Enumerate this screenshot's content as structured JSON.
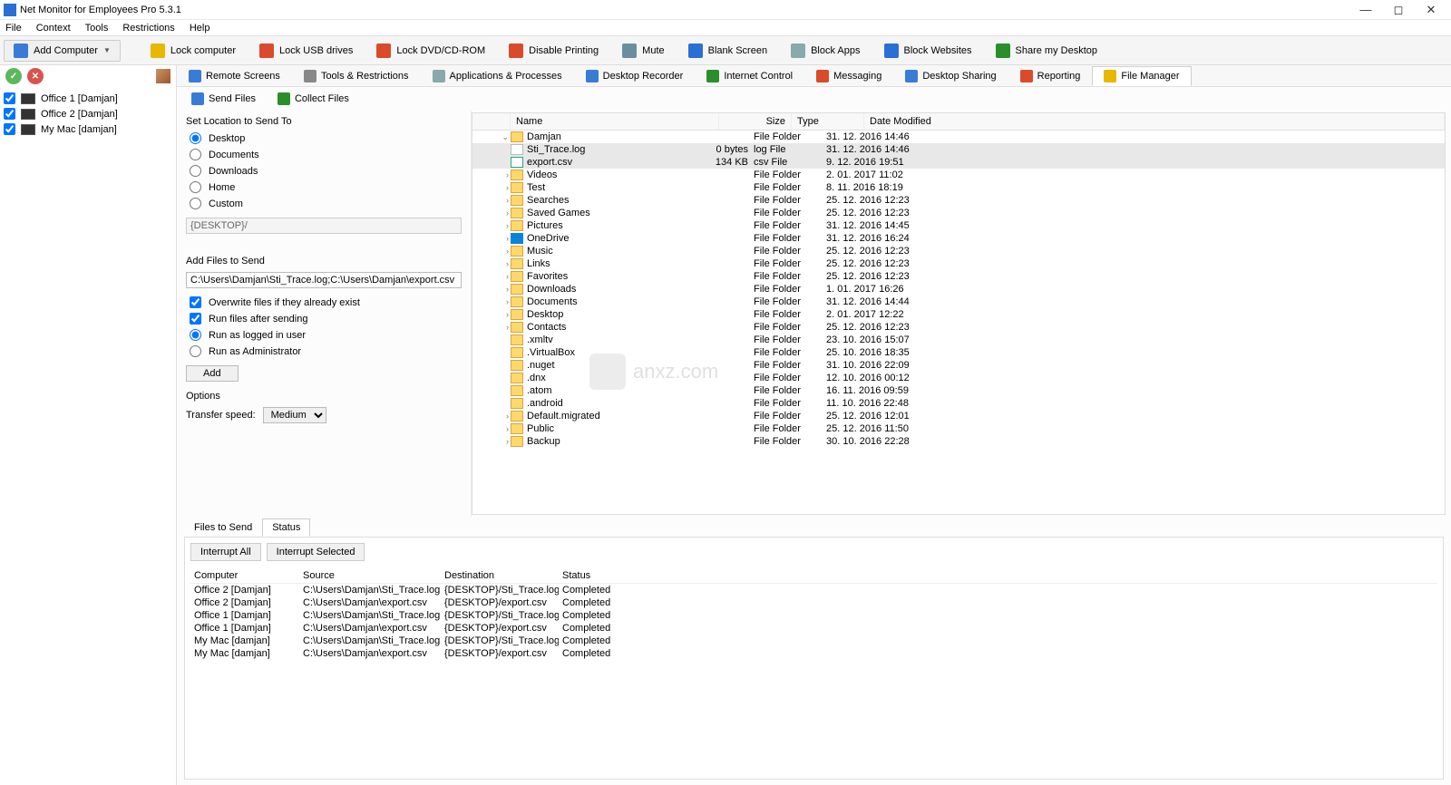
{
  "window": {
    "title": "Net Monitor for Employees Pro 5.3.1"
  },
  "menubar": [
    "File",
    "Context",
    "Tools",
    "Restrictions",
    "Help"
  ],
  "toolbar1": [
    {
      "label": "Add Computer",
      "dropdown": true,
      "color": "#3a7bd5"
    },
    {
      "label": "Lock computer",
      "color": "#e6b800"
    },
    {
      "label": "Lock USB drives",
      "color": "#d94b2b"
    },
    {
      "label": "Lock DVD/CD-ROM",
      "color": "#d94b2b"
    },
    {
      "label": "Disable Printing",
      "color": "#d94b2b"
    },
    {
      "label": "Mute",
      "color": "#6b8e9e"
    },
    {
      "label": "Blank Screen",
      "color": "#2a6fd6"
    },
    {
      "label": "Block Apps",
      "color": "#8aa"
    },
    {
      "label": "Block Websites",
      "color": "#2a6fd6"
    },
    {
      "label": "Share my Desktop",
      "color": "#2a8f2a"
    }
  ],
  "left_items": [
    {
      "label": "Office 1 [Damjan]"
    },
    {
      "label": "Office 2 [Damjan]"
    },
    {
      "label": "My Mac [damjan]"
    }
  ],
  "toolbar2_tabs": [
    {
      "label": "Remote Screens",
      "color": "#3a7bd5"
    },
    {
      "label": "Tools & Restrictions",
      "color": "#888"
    },
    {
      "label": "Applications & Processes",
      "color": "#8aa"
    },
    {
      "label": "Desktop Recorder",
      "color": "#3a7bd5"
    },
    {
      "label": "Internet Control",
      "color": "#2a8f2a"
    },
    {
      "label": "Messaging",
      "color": "#d94b2b"
    },
    {
      "label": "Desktop Sharing",
      "color": "#3a7bd5"
    },
    {
      "label": "Reporting",
      "color": "#d94b2b"
    },
    {
      "label": "File Manager",
      "color": "#e6b800",
      "active": true
    }
  ],
  "sub_toolbar": [
    {
      "label": "Send Files",
      "color": "#3a7bd5"
    },
    {
      "label": "Collect Files",
      "color": "#2a8f2a"
    }
  ],
  "settings": {
    "set_location_label": "Set Location to Send To",
    "loc_options": [
      "Desktop",
      "Documents",
      "Downloads",
      "Home",
      "Custom"
    ],
    "loc_selected": "Desktop",
    "path_display": "{DESKTOP}/",
    "add_files_label": "Add Files to Send",
    "files_input": "C:\\Users\\Damjan\\Sti_Trace.log;C:\\Users\\Damjan\\export.csv",
    "overwrite_label": "Overwrite files if they already exist",
    "run_after_label": "Run files after sending",
    "run_as_options": [
      "Run as logged in user",
      "Run as Administrator"
    ],
    "run_as_selected": "Run as logged in user",
    "add_button": "Add",
    "options_label": "Options",
    "transfer_speed_label": "Transfer speed:",
    "transfer_speed_value": "Medium"
  },
  "filelist": {
    "columns": [
      "Name",
      "Size",
      "Type",
      "Date Modified"
    ],
    "rows": [
      {
        "tree": "v",
        "indent": 0,
        "icon": "folder",
        "name": "Damjan",
        "size": "",
        "type": "File Folder",
        "date": "31. 12. 2016 14:46"
      },
      {
        "tree": "",
        "indent": 2,
        "icon": "file",
        "name": "Sti_Trace.log",
        "size": "0 bytes",
        "type": "log File",
        "date": "31. 12. 2016 14:46",
        "selected": true
      },
      {
        "tree": "",
        "indent": 2,
        "icon": "csv",
        "name": "export.csv",
        "size": "134 KB",
        "type": "csv File",
        "date": "9. 12. 2016 19:51",
        "selected": true
      },
      {
        "tree": ">",
        "indent": 1,
        "icon": "folder",
        "name": "Videos",
        "size": "",
        "type": "File Folder",
        "date": "2. 01. 2017 11:02"
      },
      {
        "tree": ">",
        "indent": 1,
        "icon": "folder",
        "name": "Test",
        "size": "",
        "type": "File Folder",
        "date": "8. 11. 2016 18:19"
      },
      {
        "tree": ">",
        "indent": 1,
        "icon": "folder",
        "name": "Searches",
        "size": "",
        "type": "File Folder",
        "date": "25. 12. 2016 12:23"
      },
      {
        "tree": ">",
        "indent": 1,
        "icon": "folder",
        "name": "Saved Games",
        "size": "",
        "type": "File Folder",
        "date": "25. 12. 2016 12:23"
      },
      {
        "tree": ">",
        "indent": 1,
        "icon": "folder",
        "name": "Pictures",
        "size": "",
        "type": "File Folder",
        "date": "31. 12. 2016 14:45"
      },
      {
        "tree": ">",
        "indent": 1,
        "icon": "onedrive",
        "name": "OneDrive",
        "size": "",
        "type": "File Folder",
        "date": "31. 12. 2016 16:24"
      },
      {
        "tree": ">",
        "indent": 1,
        "icon": "folder",
        "name": "Music",
        "size": "",
        "type": "File Folder",
        "date": "25. 12. 2016 12:23"
      },
      {
        "tree": ">",
        "indent": 1,
        "icon": "folder",
        "name": "Links",
        "size": "",
        "type": "File Folder",
        "date": "25. 12. 2016 12:23"
      },
      {
        "tree": ">",
        "indent": 1,
        "icon": "folder",
        "name": "Favorites",
        "size": "",
        "type": "File Folder",
        "date": "25. 12. 2016 12:23"
      },
      {
        "tree": ">",
        "indent": 1,
        "icon": "folder",
        "name": "Downloads",
        "size": "",
        "type": "File Folder",
        "date": "1. 01. 2017 16:26"
      },
      {
        "tree": ">",
        "indent": 1,
        "icon": "folder",
        "name": "Documents",
        "size": "",
        "type": "File Folder",
        "date": "31. 12. 2016 14:44"
      },
      {
        "tree": ">",
        "indent": 1,
        "icon": "folder",
        "name": "Desktop",
        "size": "",
        "type": "File Folder",
        "date": "2. 01. 2017 12:22"
      },
      {
        "tree": ">",
        "indent": 1,
        "icon": "folder",
        "name": "Contacts",
        "size": "",
        "type": "File Folder",
        "date": "25. 12. 2016 12:23"
      },
      {
        "tree": "",
        "indent": 1,
        "icon": "folder",
        "name": ".xmltv",
        "size": "",
        "type": "File Folder",
        "date": "23. 10. 2016 15:07"
      },
      {
        "tree": "",
        "indent": 1,
        "icon": "folder",
        "name": ".VirtualBox",
        "size": "",
        "type": "File Folder",
        "date": "25. 10. 2016 18:35"
      },
      {
        "tree": "",
        "indent": 1,
        "icon": "folder",
        "name": ".nuget",
        "size": "",
        "type": "File Folder",
        "date": "31. 10. 2016 22:09"
      },
      {
        "tree": "",
        "indent": 1,
        "icon": "folder",
        "name": ".dnx",
        "size": "",
        "type": "File Folder",
        "date": "12. 10. 2016 00:12"
      },
      {
        "tree": "",
        "indent": 1,
        "icon": "folder",
        "name": ".atom",
        "size": "",
        "type": "File Folder",
        "date": "16. 11. 2016 09:59"
      },
      {
        "tree": "",
        "indent": 1,
        "icon": "folder",
        "name": ".android",
        "size": "",
        "type": "File Folder",
        "date": "11. 10. 2016 22:48"
      },
      {
        "tree": ">",
        "indent": 0,
        "icon": "folder",
        "name": "Default.migrated",
        "size": "",
        "type": "File Folder",
        "date": "25. 12. 2016 12:01"
      },
      {
        "tree": ">",
        "indent": 0,
        "icon": "folder",
        "name": "Public",
        "size": "",
        "type": "File Folder",
        "date": "25. 12. 2016 11:50"
      },
      {
        "tree": ">",
        "indent": 0,
        "icon": "folder",
        "name": "Backup",
        "size": "",
        "type": "File Folder",
        "date": "30. 10. 2016 22:28"
      }
    ]
  },
  "bottom_tabs": {
    "tabs": [
      "Files to Send",
      "Status"
    ],
    "active": "Status"
  },
  "status_panel": {
    "interrupt_all": "Interrupt All",
    "interrupt_selected": "Interrupt Selected",
    "columns": [
      "Computer",
      "Source",
      "Destination",
      "Status"
    ],
    "rows": [
      {
        "computer": "Office 2 [Damjan]",
        "source": "C:\\Users\\Damjan\\Sti_Trace.log",
        "destination": "{DESKTOP}/Sti_Trace.log",
        "status": "Completed"
      },
      {
        "computer": "Office 2 [Damjan]",
        "source": "C:\\Users\\Damjan\\export.csv",
        "destination": "{DESKTOP}/export.csv",
        "status": "Completed"
      },
      {
        "computer": "Office 1 [Damjan]",
        "source": "C:\\Users\\Damjan\\Sti_Trace.log",
        "destination": "{DESKTOP}/Sti_Trace.log",
        "status": "Completed"
      },
      {
        "computer": "Office 1 [Damjan]",
        "source": "C:\\Users\\Damjan\\export.csv",
        "destination": "{DESKTOP}/export.csv",
        "status": "Completed"
      },
      {
        "computer": "My Mac [damjan]",
        "source": "C:\\Users\\Damjan\\Sti_Trace.log",
        "destination": "{DESKTOP}/Sti_Trace.log",
        "status": "Completed"
      },
      {
        "computer": "My Mac [damjan]",
        "source": "C:\\Users\\Damjan\\export.csv",
        "destination": "{DESKTOP}/export.csv",
        "status": "Completed"
      }
    ]
  },
  "watermark": "anxz.com"
}
